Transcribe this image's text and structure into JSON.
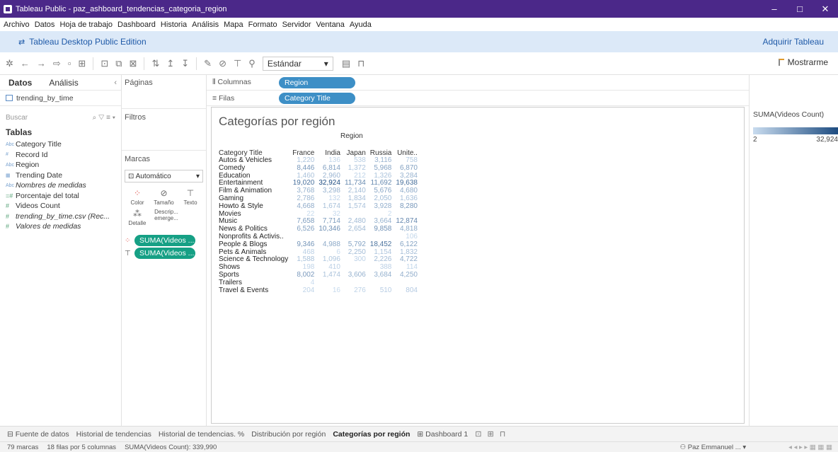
{
  "window": {
    "title": "Tableau Public - paz_ashboard_tendencias_categoria_region",
    "min": "–",
    "max": "□",
    "close": "✕"
  },
  "menu": [
    "Archivo",
    "Datos",
    "Hoja de trabajo",
    "Dashboard",
    "Historia",
    "Análisis",
    "Mapa",
    "Formato",
    "Servidor",
    "Ventana",
    "Ayuda"
  ],
  "edition": {
    "label": "Tableau Desktop Public Edition",
    "acquire": "Adquirir Tableau"
  },
  "toolbar": {
    "standard": "Estándar",
    "showme": "Mostrarme"
  },
  "left": {
    "tab_data": "Datos",
    "tab_analysis": "Análisis",
    "datasource": "trending_by_time",
    "search_placeholder": "Buscar",
    "tables_title": "Tablas",
    "fields": [
      {
        "type": "Abc",
        "name": "Category Title",
        "italic": false,
        "measure": false
      },
      {
        "type": "#",
        "name": "Record Id",
        "italic": false,
        "measure": false
      },
      {
        "type": "Abc",
        "name": "Region",
        "italic": false,
        "measure": false
      },
      {
        "type": "▦",
        "name": "Trending Date",
        "italic": false,
        "measure": false
      },
      {
        "type": "Abc",
        "name": "Nombres de medidas",
        "italic": true,
        "measure": false
      },
      {
        "type": "=#",
        "name": "Porcentaje del total",
        "italic": false,
        "measure": true
      },
      {
        "type": "#",
        "name": "Videos Count",
        "italic": false,
        "measure": true
      },
      {
        "type": "#",
        "name": "trending_by_time.csv (Rec...",
        "italic": true,
        "measure": true
      },
      {
        "type": "#",
        "name": "Valores de medidas",
        "italic": true,
        "measure": true
      }
    ]
  },
  "mid": {
    "pages": "Páginas",
    "filters": "Filtros",
    "marks": "Marcas",
    "marks_type": "Automático",
    "btn_color": "Color",
    "btn_size": "Tamaño",
    "btn_text": "Texto",
    "btn_detail": "Detalle",
    "btn_tooltip": "Descrip... emerge...",
    "pill1": "SUMA(Videos ...",
    "pill2": "SUMA(Videos ..."
  },
  "shelves": {
    "columns_label": "Columnas",
    "columns_pill": "Region",
    "rows_label": "Filas",
    "rows_pill": "Category Title"
  },
  "viz": {
    "title": "Categorías por región",
    "col_header": "Region",
    "row_header": "Category Title",
    "columns": [
      "France",
      "India",
      "Japan",
      "Russia",
      "Unite.."
    ],
    "rows": [
      {
        "label": "Autos & Vehicles",
        "values": [
          "1,220",
          "136",
          "538",
          "3,116",
          "758"
        ]
      },
      {
        "label": "Comedy",
        "values": [
          "8,446",
          "6,814",
          "1,372",
          "5,968",
          "6,870"
        ]
      },
      {
        "label": "Education",
        "values": [
          "1,460",
          "2,960",
          "212",
          "1,326",
          "3,284"
        ]
      },
      {
        "label": "Entertainment",
        "values": [
          "19,020",
          "32,924",
          "11,734",
          "11,692",
          "19,638"
        ]
      },
      {
        "label": "Film & Animation",
        "values": [
          "3,768",
          "3,298",
          "2,140",
          "5,676",
          "4,680"
        ]
      },
      {
        "label": "Gaming",
        "values": [
          "2,786",
          "132",
          "1,834",
          "2,050",
          "1,636"
        ]
      },
      {
        "label": "Howto & Style",
        "values": [
          "4,668",
          "1,674",
          "1,574",
          "3,928",
          "8,280"
        ]
      },
      {
        "label": "Movies",
        "values": [
          "22",
          "32",
          "",
          "2",
          ""
        ]
      },
      {
        "label": "Music",
        "values": [
          "7,658",
          "7,714",
          "2,480",
          "3,664",
          "12,874"
        ]
      },
      {
        "label": "News & Politics",
        "values": [
          "6,526",
          "10,346",
          "2,654",
          "9,858",
          "4,818"
        ]
      },
      {
        "label": "Nonprofits & Activis..",
        "values": [
          "",
          "",
          "",
          "",
          "106"
        ]
      },
      {
        "label": "People & Blogs",
        "values": [
          "9,346",
          "4,988",
          "5,792",
          "18,452",
          "6,122"
        ]
      },
      {
        "label": "Pets & Animals",
        "values": [
          "468",
          "6",
          "2,250",
          "1,154",
          "1,832"
        ]
      },
      {
        "label": "Science & Technology",
        "values": [
          "1,588",
          "1,096",
          "300",
          "2,226",
          "4,722"
        ]
      },
      {
        "label": "Shows",
        "values": [
          "198",
          "410",
          "",
          "388",
          "114"
        ]
      },
      {
        "label": "Sports",
        "values": [
          "8,002",
          "1,474",
          "3,606",
          "3,684",
          "4,250"
        ]
      },
      {
        "label": "Trailers",
        "values": [
          "4",
          "",
          "",
          "",
          ""
        ]
      },
      {
        "label": "Travel & Events",
        "values": [
          "204",
          "16",
          "276",
          "510",
          "804"
        ]
      }
    ],
    "color_min": "#c9dcef",
    "color_max": "#1c4b80"
  },
  "legend": {
    "title": "SUMA(Videos Count)",
    "min": "2",
    "max": "32,924"
  },
  "sheet_tabs": {
    "datasource": "Fuente de datos",
    "tabs": [
      "Historial de tendencias",
      "Historial de tendencias. %",
      "Distribución por región",
      "Categorías por región"
    ],
    "active": "Categorías por región",
    "dashboard": "Dashboard 1"
  },
  "status": {
    "marks": "79 marcas",
    "rows_cols": "18 filas por 5 columnas",
    "sum": "SUMA(Videos Count): 339,990",
    "user": "Paz Emmanuel ..."
  }
}
